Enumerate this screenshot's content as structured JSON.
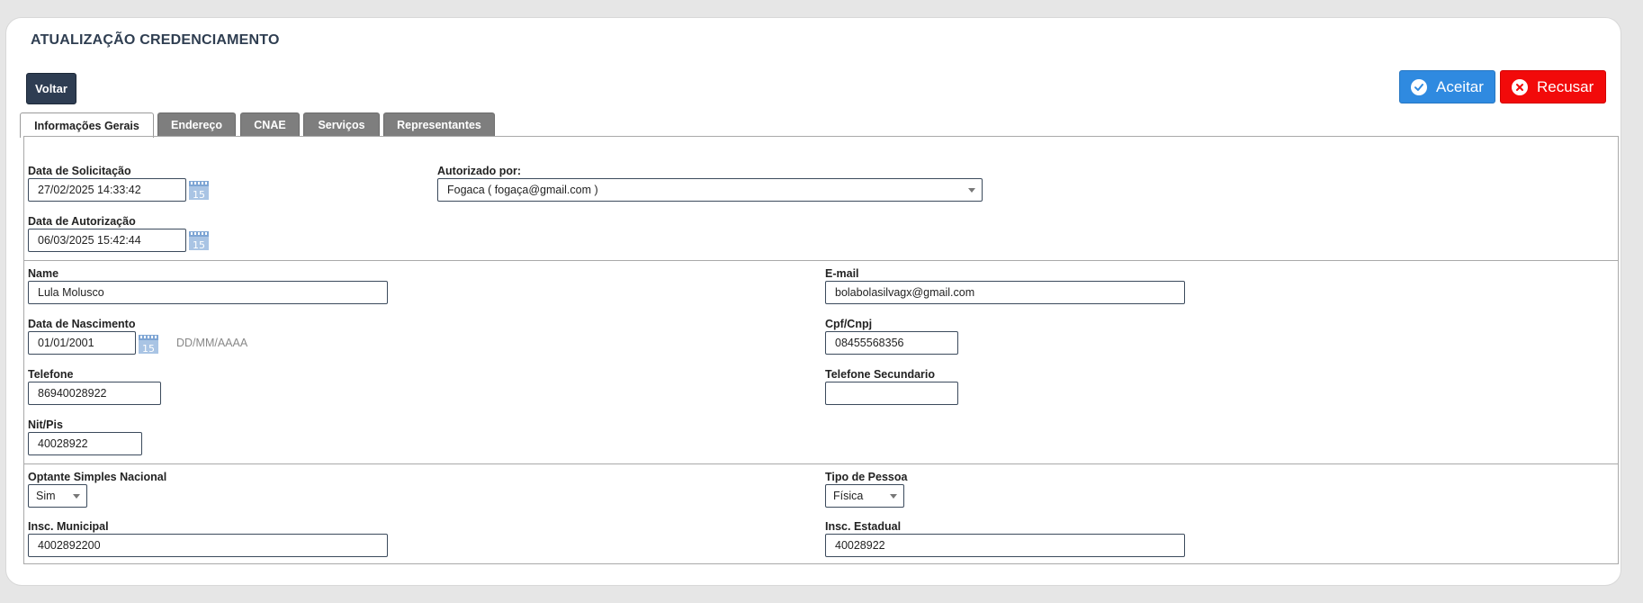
{
  "page": {
    "title": "ATUALIZAÇÃO CREDENCIAMENTO"
  },
  "actions": {
    "back_label": "Voltar",
    "accept_label": "Aceitar",
    "reject_label": "Recusar"
  },
  "tabs": [
    {
      "label": "Informações Gerais",
      "active": true
    },
    {
      "label": "Endereço",
      "active": false
    },
    {
      "label": "CNAE",
      "active": false
    },
    {
      "label": "Serviços",
      "active": false
    },
    {
      "label": "Representantes",
      "active": false
    }
  ],
  "request": {
    "solicitacao_label": "Data de Solicitação",
    "solicitacao_value": "27/02/2025 14:33:42",
    "autorizado_label": "Autorizado por:",
    "autorizado_value": "Fogaca ( fogaça@gmail.com )",
    "autorizacao_label": "Data de Autorização",
    "autorizacao_value": "06/03/2025 15:42:44"
  },
  "person": {
    "name_label": "Name",
    "name_value": "Lula Molusco",
    "email_label": "E-mail",
    "email_value": "bolabolasilvagx@gmail.com",
    "nascimento_label": "Data de Nascimento",
    "nascimento_value": "01/01/2001",
    "nascimento_hint": "DD/MM/AAAA",
    "cpf_label": "Cpf/Cnpj",
    "cpf_value": "08455568356",
    "telefone_label": "Telefone",
    "telefone_value": "86940028922",
    "telefone2_label": "Telefone Secundario",
    "telefone2_value": "",
    "nit_label": "Nit/Pis",
    "nit_value": "40028922"
  },
  "fiscal": {
    "simples_label": "Optante Simples Nacional",
    "simples_value": "Sim",
    "tipo_label": "Tipo de Pessoa",
    "tipo_value": "Física",
    "municipal_label": "Insc. Municipal",
    "municipal_value": "4002892200",
    "estadual_label": "Insc. Estadual",
    "estadual_value": "40028922"
  },
  "colors": {
    "accent": "#2f8ae0",
    "danger": "#f20a0a",
    "dark": "#2e3d52"
  }
}
